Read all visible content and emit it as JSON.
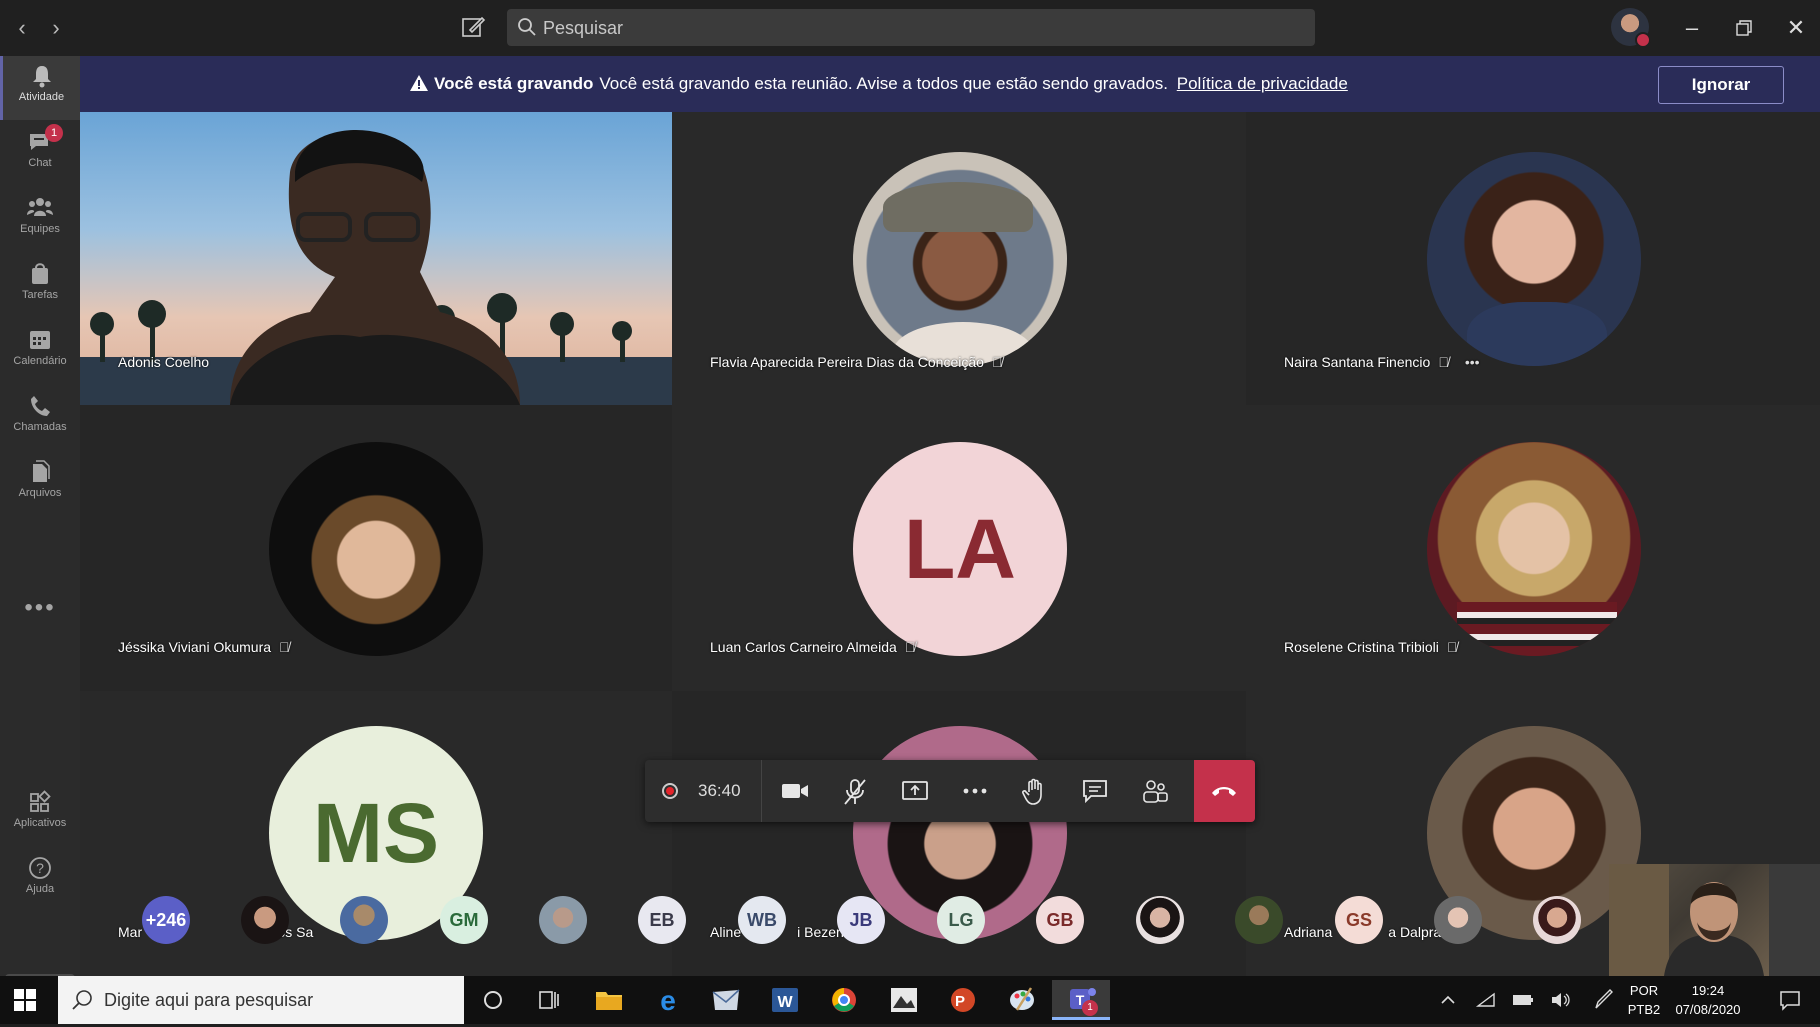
{
  "titlebar": {
    "search_placeholder": "Pesquisar"
  },
  "rail": {
    "items": [
      {
        "label": "Atividade",
        "icon": "bell-icon"
      },
      {
        "label": "Chat",
        "icon": "chat-icon",
        "badge": "1"
      },
      {
        "label": "Equipes",
        "icon": "teams-icon"
      },
      {
        "label": "Tarefas",
        "icon": "tasks-icon"
      },
      {
        "label": "Calendário",
        "icon": "calendar-icon"
      },
      {
        "label": "Chamadas",
        "icon": "phone-icon"
      },
      {
        "label": "Arquivos",
        "icon": "files-icon"
      }
    ],
    "more": "•••",
    "apps_label": "Aplicativos",
    "help_label": "Ajuda"
  },
  "banner": {
    "bold": "Você está gravando",
    "text": "Você está gravando esta reunião. Avise a todos que estão sendo gravados.",
    "link": "Política de privacidade",
    "button": "Ignorar"
  },
  "participants": [
    {
      "name": "Adonis Coelho",
      "type": "video"
    },
    {
      "name": "Flavia Aparecida Pereira Dias da Conceição",
      "type": "photo",
      "muted": true
    },
    {
      "name": "Naira Santana Finencio",
      "type": "photo",
      "muted": true
    },
    {
      "name": "Jéssika Viviani Okumura",
      "type": "photo",
      "muted": true
    },
    {
      "name": "Luan Carlos Carneiro Almeida",
      "type": "initials",
      "initials": "LA",
      "muted": true
    },
    {
      "name": "Roselene Cristina Tribioli",
      "type": "photo",
      "muted": true
    },
    {
      "name": "Mar",
      "name_tail": "L. dos Sa",
      "type": "initials",
      "initials": "MS"
    },
    {
      "name": "Aline",
      "name_tail": "i Bezerra",
      "type": "photo"
    },
    {
      "name": "Adriana",
      "name_tail": "a Dalpra",
      "type": "photo"
    }
  ],
  "controls": {
    "timer": "36:40"
  },
  "strip": {
    "overflow": "+246",
    "initials": [
      "GM",
      "EB",
      "WB",
      "JB",
      "LG",
      "GB",
      "GS"
    ]
  },
  "taskbar": {
    "search_placeholder": "Digite aqui para pesquisar",
    "lang_top": "POR",
    "lang_bottom": "PTB2",
    "time": "19:24",
    "date": "07/08/2020",
    "teams_badge": "1"
  },
  "colors": {
    "banner": "#2a2c58",
    "hangup": "#c4314b",
    "accent": "#6264a7"
  }
}
